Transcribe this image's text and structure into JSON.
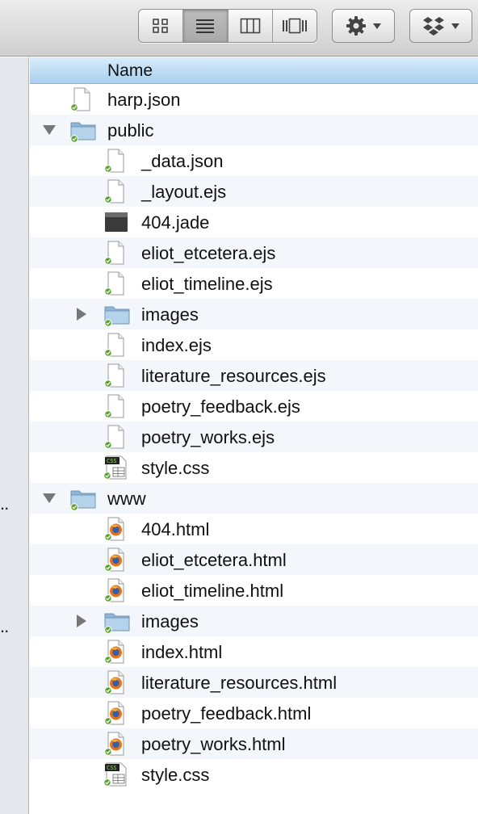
{
  "toolbar": {
    "view_buttons": [
      {
        "name": "icon-view-button",
        "icon": "grid-icon",
        "active": false
      },
      {
        "name": "list-view-button",
        "icon": "list-icon",
        "active": true
      },
      {
        "name": "column-view-button",
        "icon": "columns-icon",
        "active": false
      },
      {
        "name": "coverflow-view-button",
        "icon": "coverflow-icon",
        "active": false
      }
    ],
    "action_icon": "gear-icon",
    "dropbox_icon": "dropbox-icon"
  },
  "sidebar": {
    "truncated_items": [
      "..",
      ".."
    ]
  },
  "list": {
    "column_header": "Name",
    "rows": [
      {
        "label": "harp.json",
        "depth": 0,
        "type": "file",
        "disclosure": "none"
      },
      {
        "label": "public",
        "depth": 0,
        "type": "folder",
        "disclosure": "open"
      },
      {
        "label": "_data.json",
        "depth": 1,
        "type": "file",
        "disclosure": "none"
      },
      {
        "label": "_layout.ejs",
        "depth": 1,
        "type": "file",
        "disclosure": "none"
      },
      {
        "label": "404.jade",
        "depth": 1,
        "type": "dark",
        "disclosure": "none"
      },
      {
        "label": "eliot_etcetera.ejs",
        "depth": 1,
        "type": "file",
        "disclosure": "none"
      },
      {
        "label": "eliot_timeline.ejs",
        "depth": 1,
        "type": "file",
        "disclosure": "none"
      },
      {
        "label": "images",
        "depth": 1,
        "type": "folder",
        "disclosure": "closed"
      },
      {
        "label": "index.ejs",
        "depth": 1,
        "type": "file",
        "disclosure": "none"
      },
      {
        "label": "literature_resources.ejs",
        "depth": 1,
        "type": "file",
        "disclosure": "none"
      },
      {
        "label": "poetry_feedback.ejs",
        "depth": 1,
        "type": "file",
        "disclosure": "none"
      },
      {
        "label": "poetry_works.ejs",
        "depth": 1,
        "type": "file",
        "disclosure": "none"
      },
      {
        "label": "style.css",
        "depth": 1,
        "type": "css",
        "disclosure": "none"
      },
      {
        "label": "www",
        "depth": 0,
        "type": "folder",
        "disclosure": "open"
      },
      {
        "label": "404.html",
        "depth": 1,
        "type": "html",
        "disclosure": "none"
      },
      {
        "label": "eliot_etcetera.html",
        "depth": 1,
        "type": "html",
        "disclosure": "none"
      },
      {
        "label": "eliot_timeline.html",
        "depth": 1,
        "type": "html",
        "disclosure": "none"
      },
      {
        "label": "images",
        "depth": 1,
        "type": "folder",
        "disclosure": "closed"
      },
      {
        "label": "index.html",
        "depth": 1,
        "type": "html",
        "disclosure": "none"
      },
      {
        "label": "literature_resources.html",
        "depth": 1,
        "type": "html",
        "disclosure": "none"
      },
      {
        "label": "poetry_feedback.html",
        "depth": 1,
        "type": "html",
        "disclosure": "none"
      },
      {
        "label": "poetry_works.html",
        "depth": 1,
        "type": "html",
        "disclosure": "none"
      },
      {
        "label": "style.css",
        "depth": 1,
        "type": "css",
        "disclosure": "none"
      }
    ]
  }
}
